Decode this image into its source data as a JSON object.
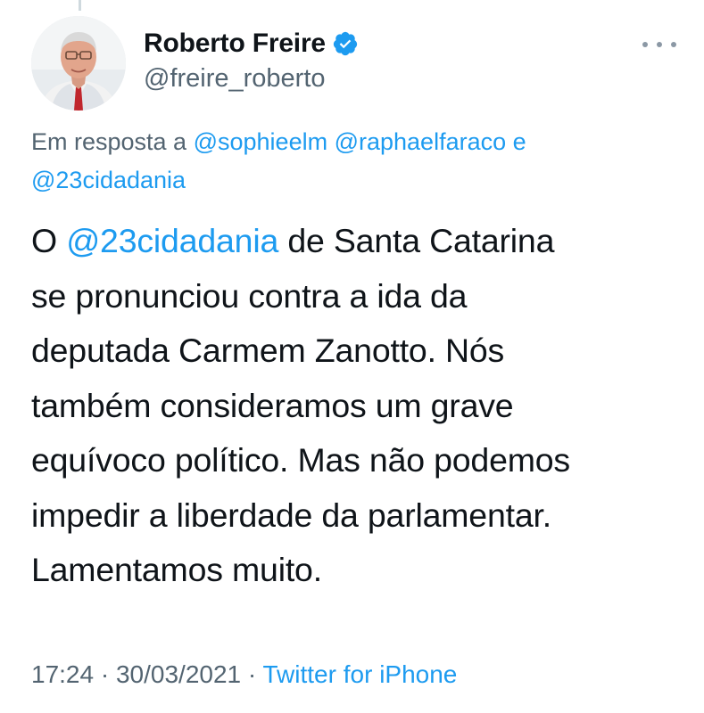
{
  "tweet": {
    "author": {
      "name": "Roberto Freire",
      "handle": "@freire_roberto",
      "verified": true
    },
    "reply": {
      "prefix": "Em resposta a",
      "mention_1": "@sophieelm",
      "mention_2": "@raphaelfaraco",
      "conjunction": "e",
      "mention_3": "@23cidadania"
    },
    "text": {
      "line1_start": "O ",
      "line1_mention": "@23cidadania",
      "line1_end": " de Santa Catarina",
      "line2": "se pronunciou contra a ida da",
      "line3": "deputada Carmem Zanotto. Nós",
      "line4": "também consideramos um grave",
      "line5": "equívoco político. Mas não podemos",
      "line6": "impedir a liberdade da parlamentar.",
      "line7": "Lamentamos muito."
    },
    "meta": {
      "time": "17:24",
      "separator": " · ",
      "date": "30/03/2021",
      "source": "Twitter for iPhone"
    }
  },
  "icons": {
    "verified": "verified-badge-icon",
    "more": "more-options-icon"
  },
  "colors": {
    "link": "#1d9bf0",
    "secondary": "#536471",
    "primary": "#0f1419"
  }
}
